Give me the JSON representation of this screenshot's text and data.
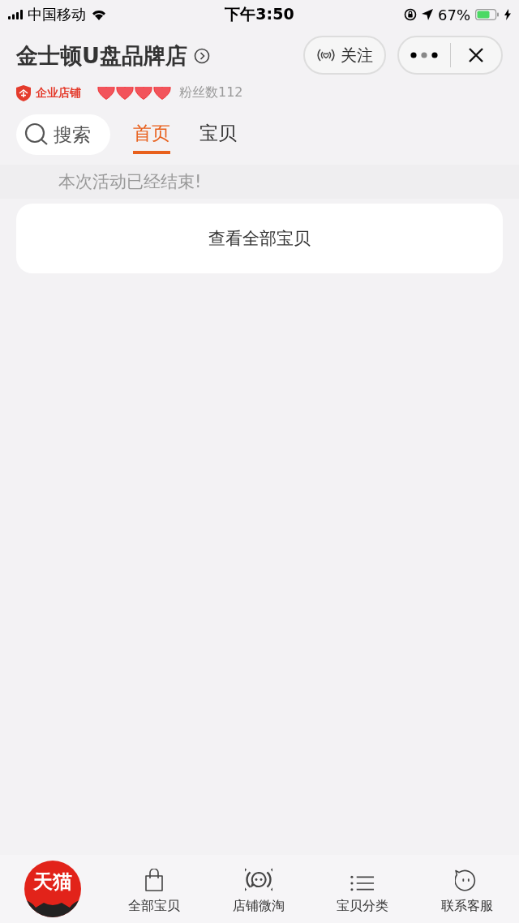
{
  "status_bar": {
    "carrier": "中国移动",
    "time": "下午3:50",
    "battery": "67%"
  },
  "header": {
    "shop_name": "金士顿U盘品牌店",
    "follow_button": "关注",
    "badge": "企业店铺",
    "stars": 4,
    "fans": "粉丝数112"
  },
  "search": {
    "placeholder": "搜索"
  },
  "tabs": [
    {
      "label": "首页",
      "selected": true
    },
    {
      "label": "宝贝",
      "selected": false
    }
  ],
  "notice": "本次活动已经结束!",
  "view_all_button": "查看全部宝贝",
  "bottom_nav": {
    "logo": "天猫",
    "items": [
      {
        "label": "全部宝贝",
        "kind": "bag"
      },
      {
        "label": "店铺微淘",
        "kind": "broadcast"
      },
      {
        "label": "宝贝分类",
        "kind": "list"
      },
      {
        "label": "联系客服",
        "kind": "chat"
      }
    ]
  }
}
